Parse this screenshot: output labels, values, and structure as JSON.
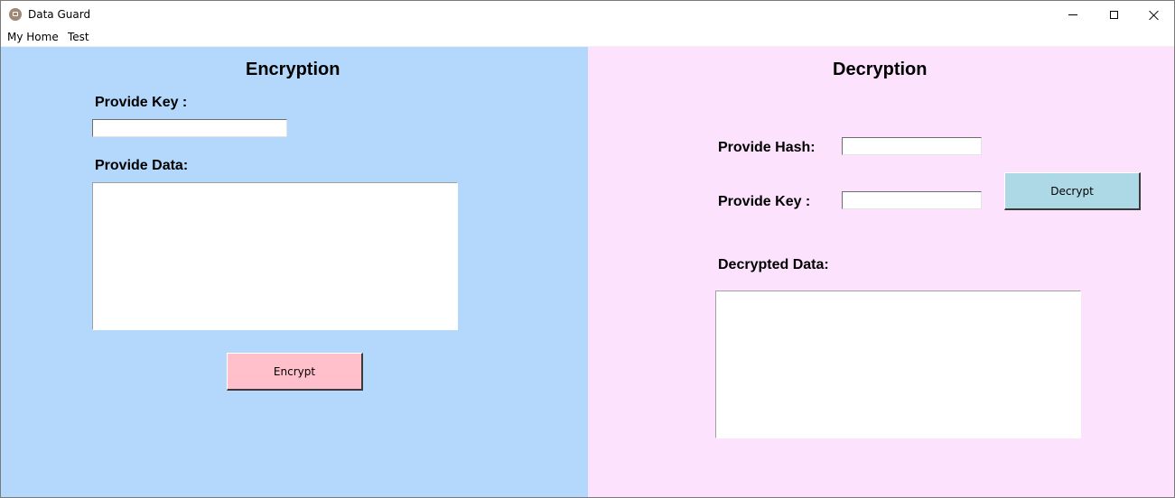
{
  "window": {
    "title": "Data Guard",
    "app_icon": "app-icon",
    "controls": [
      "minimize-icon",
      "maximize-icon",
      "close-icon"
    ]
  },
  "menu": {
    "items": [
      {
        "label": "My Home"
      },
      {
        "label": "Test"
      }
    ]
  },
  "encryption": {
    "heading": "Encryption",
    "key_label": "Provide Key :",
    "key_value": "",
    "data_label": "Provide Data:",
    "data_value": "",
    "button_label": "Encrypt",
    "background_color": "#b3d8fb",
    "button_color": "#ffc0cb"
  },
  "decryption": {
    "heading": "Decryption",
    "hash_label": "Provide Hash:",
    "hash_value": "",
    "key_label": "Provide Key :",
    "key_value": "",
    "button_label": "Decrypt",
    "result_label": "Decrypted Data:",
    "result_value": "",
    "background_color": "#fce2fd",
    "button_color": "#add8e6"
  }
}
